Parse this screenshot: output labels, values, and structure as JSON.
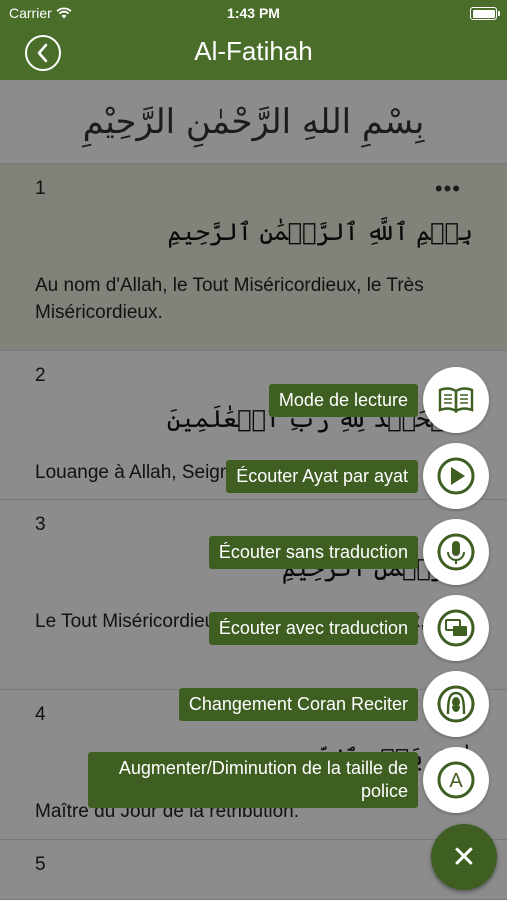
{
  "status_bar": {
    "carrier": "Carrier",
    "time": "1:43 PM"
  },
  "nav": {
    "title": "Al-Fatihah"
  },
  "header": {
    "bismillah": "بِسْمِ اللهِ الرَّحْمٰنِ الرَّحِيْمِ"
  },
  "ayahs": [
    {
      "number": "1",
      "arabic": "بِسۡمِ ٱللَّهِ ٱلرَّحۡمَٰنِ ٱلرَّحِيمِ",
      "translation": "Au nom d'Allah, le Tout Miséricordieux, le Très Miséricordieux."
    },
    {
      "number": "2",
      "arabic": "ٱلۡحَمۡدُ لِلَّهِ رَبِّ ٱلۡعَٰلَمِينَ",
      "translation": "Louange à Allah, Seigneur de l'univers."
    },
    {
      "number": "3",
      "arabic": "ٱلرَّحۡمَٰنِ ٱلرَّحِيمِ",
      "translation": "Le Tout Miséricordieux, le Très Miséricordieux,"
    },
    {
      "number": "4",
      "arabic": "مَٰلِكِ يَوۡمِ ٱلدِّينِ",
      "translation": "Maître du Jour de la rétribution."
    },
    {
      "number": "5",
      "arabic": "",
      "translation": ""
    }
  ],
  "fab_menu": [
    {
      "label": "Mode de lecture",
      "icon": "book-icon"
    },
    {
      "label": "Écouter Ayat par ayat",
      "icon": "play-icon"
    },
    {
      "label": "Écouter sans traduction",
      "icon": "microphone-icon"
    },
    {
      "label": "Écouter avec traduction",
      "icon": "chat-bubbles-icon"
    },
    {
      "label": "Changement Coran Reciter",
      "icon": "reciter-icon"
    },
    {
      "label": "Augmenter/Diminution de la taille de police",
      "icon": "font-size-icon"
    }
  ],
  "fab_close": "✕",
  "colors": {
    "primary": "#4b6d2a",
    "label_bg": "#3f5e22",
    "highlight": "#e9eedc"
  }
}
